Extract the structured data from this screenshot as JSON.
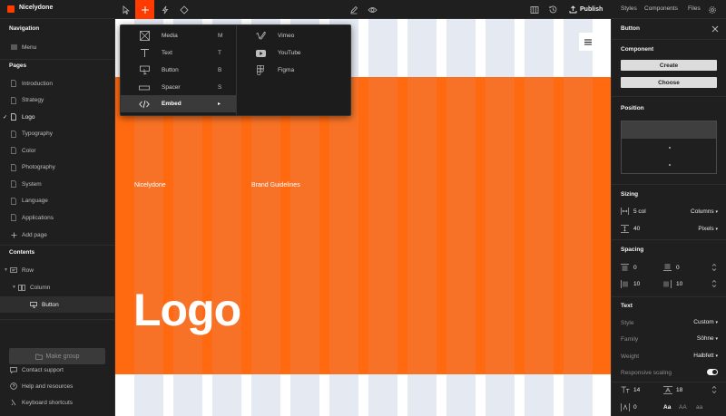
{
  "app": {
    "name": "Nicelydone",
    "brand_color": "#ff3b00"
  },
  "toolbar": {
    "publish_label": "Publish"
  },
  "right_tabs": [
    "Styles",
    "Components",
    "Files"
  ],
  "left": {
    "navigation_title": "Navigation",
    "menu_label": "Menu",
    "pages_title": "Pages",
    "pages": [
      "Introduction",
      "Strategy",
      "Logo",
      "Typography",
      "Color",
      "Photography",
      "System",
      "Language",
      "Applications"
    ],
    "add_page": "Add page",
    "contents_title": "Contents",
    "tree": [
      {
        "label": "Row"
      },
      {
        "label": "Column"
      },
      {
        "label": "Button"
      }
    ],
    "make_group": "Make group",
    "footer": [
      "Contact support",
      "Help and resources",
      "Keyboard shortcuts"
    ]
  },
  "canvas": {
    "site_name": "Nicelydone",
    "nav_link": "Brand Guidelines",
    "hero_title": "Logo",
    "accent": "#ff6a10"
  },
  "dropdown": {
    "left": [
      {
        "label": "Media",
        "key": "M",
        "icon": "media-icon"
      },
      {
        "label": "Text",
        "key": "T",
        "icon": "text-icon"
      },
      {
        "label": "Button",
        "key": "B",
        "icon": "button-icon"
      },
      {
        "label": "Spacer",
        "key": "S",
        "icon": "spacer-icon"
      },
      {
        "label": "Embed",
        "key": "▸",
        "icon": "embed-icon"
      }
    ],
    "right": [
      {
        "label": "Vimeo",
        "icon": "vimeo-icon"
      },
      {
        "label": "YouTube",
        "icon": "youtube-icon"
      },
      {
        "label": "Figma",
        "icon": "figma-icon"
      }
    ]
  },
  "panel": {
    "title": "Button",
    "component_title": "Component",
    "create": "Create",
    "choose": "Choose",
    "position_title": "Position",
    "sizing_title": "Sizing",
    "width_value": "5 col",
    "width_unit": "Columns",
    "height_value": "40",
    "height_unit": "Pixels",
    "spacing_title": "Spacing",
    "spacing": {
      "top": "0",
      "bottom": "0",
      "left": "10",
      "right": "10"
    },
    "text_title": "Text",
    "style_label": "Style",
    "style_value": "Custom",
    "family_label": "Family",
    "family_value": "Söhne",
    "weight_label": "Weight",
    "weight_value": "Halbfett",
    "responsive_label": "Responsive scaling",
    "font_size": "14",
    "line_height": "18",
    "letter_spacing": "0",
    "case_options": [
      "Aa",
      "AA",
      "aa"
    ]
  }
}
